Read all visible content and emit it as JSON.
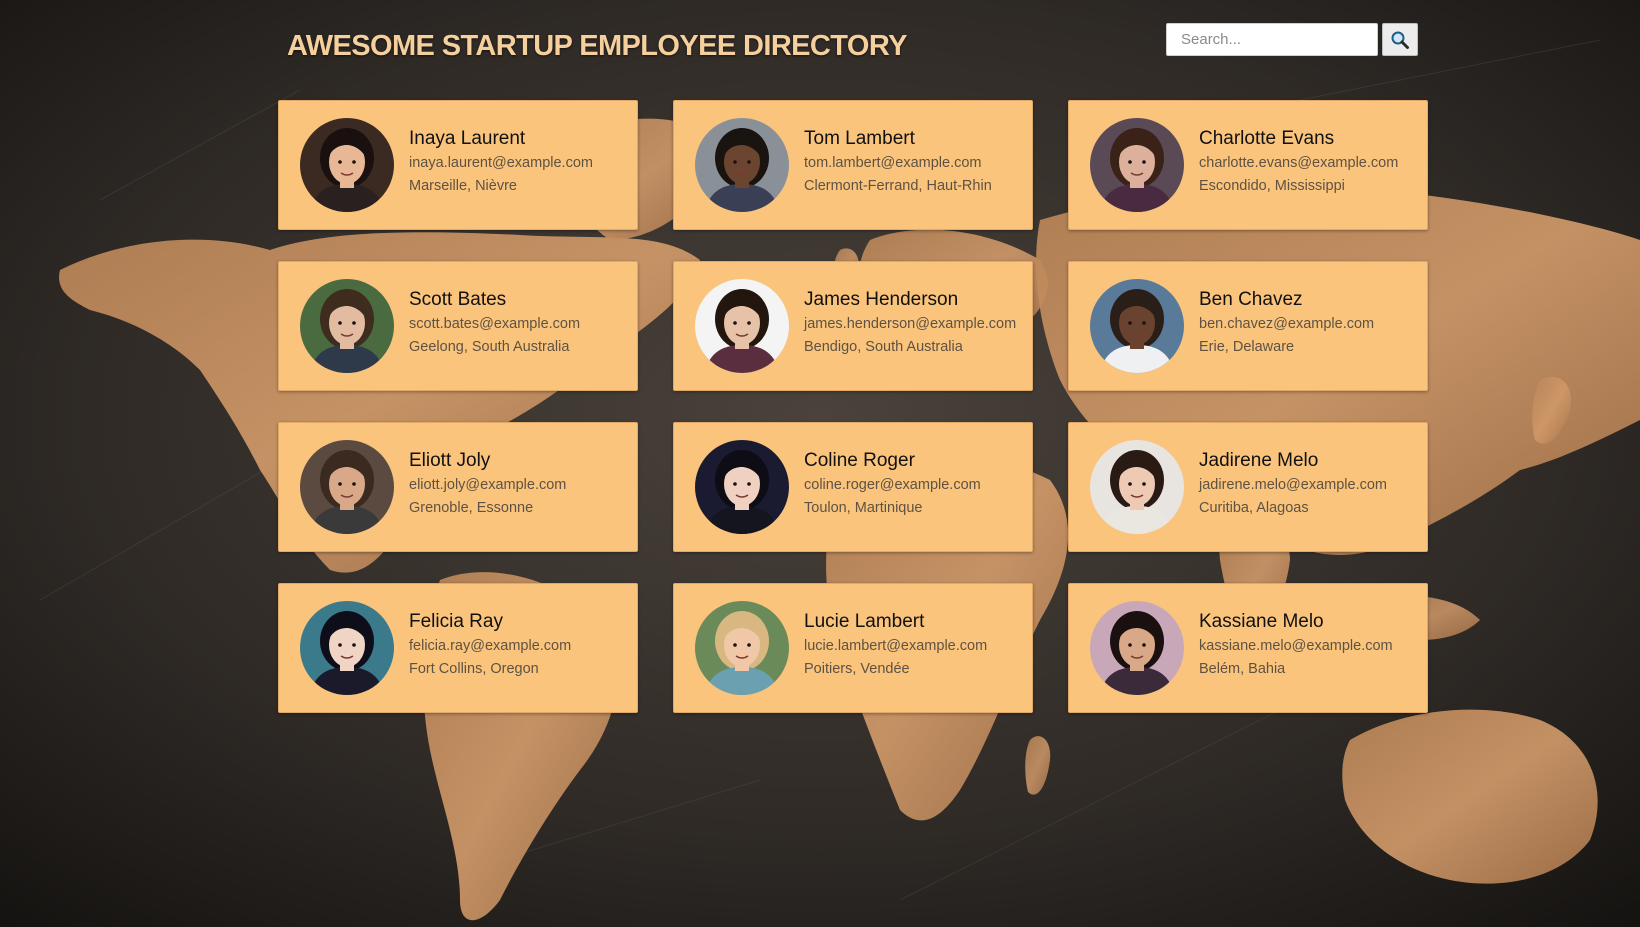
{
  "header": {
    "title": "AWESOME STARTUP EMPLOYEE DIRECTORY",
    "search_placeholder": "Search...",
    "search_icon": "magnifying-glass-icon"
  },
  "colors": {
    "title": "#f5cf9c",
    "card_background": "#fac47d",
    "page_background": "#2a2622",
    "map_land": "#c08a5c"
  },
  "employees": [
    {
      "name": "Inaya Laurent",
      "email": "inaya.laurent@example.com",
      "location": "Marseille, Nièvre",
      "skin": "#e8b896",
      "hair": "#1a1010",
      "bg": "#3a2a22",
      "shirt": "#2a2020"
    },
    {
      "name": "Tom Lambert",
      "email": "tom.lambert@example.com",
      "location": "Clermont-Ferrand, Haut-Rhin",
      "skin": "#6b4530",
      "hair": "#1a1410",
      "bg": "#8a9098",
      "shirt": "#3a3f55"
    },
    {
      "name": "Charlotte Evans",
      "email": "charlotte.evans@example.com",
      "location": "Escondido, Mississippi",
      "skin": "#dcb09a",
      "hair": "#3a2218",
      "bg": "#5a4a55",
      "shirt": "#4a2a40"
    },
    {
      "name": "Scott Bates",
      "email": "scott.bates@example.com",
      "location": "Geelong, South Australia",
      "skin": "#e2bba0",
      "hair": "#3e2c1e",
      "bg": "#4a6a40",
      "shirt": "#2e3a4a"
    },
    {
      "name": "James Henderson",
      "email": "james.henderson@example.com",
      "location": "Bendigo, South Australia",
      "skin": "#e6c2a8",
      "hair": "#22160f",
      "bg": "#f4f4f4",
      "shirt": "#5a2e3e"
    },
    {
      "name": "Ben Chavez",
      "email": "ben.chavez@example.com",
      "location": "Erie, Delaware",
      "skin": "#6a4330",
      "hair": "#2a1e18",
      "bg": "#5a7a9a",
      "shirt": "#eef0f2"
    },
    {
      "name": "Eliott Joly",
      "email": "eliott.joly@example.com",
      "location": "Grenoble, Essonne",
      "skin": "#d8a888",
      "hair": "#3a2a20",
      "bg": "#5a4a40",
      "shirt": "#3a3a3a"
    },
    {
      "name": "Coline Roger",
      "email": "coline.roger@example.com",
      "location": "Toulon, Martinique",
      "skin": "#f0d0c0",
      "hair": "#0e0c14",
      "bg": "#1a1a30",
      "shirt": "#15151f"
    },
    {
      "name": "Jadirene Melo",
      "email": "jadirene.melo@example.com",
      "location": "Curitiba, Alagoas",
      "skin": "#eecab4",
      "hair": "#2a1a14",
      "bg": "#e8e4e0",
      "shirt": "#eae6e0"
    },
    {
      "name": "Felicia Ray",
      "email": "felicia.ray@example.com",
      "location": "Fort Collins, Oregon",
      "skin": "#f0d4c4",
      "hair": "#0e0e1a",
      "bg": "#3a7a8a",
      "shirt": "#1a1a2a"
    },
    {
      "name": "Lucie Lambert",
      "email": "lucie.lambert@example.com",
      "location": "Poitiers, Vendée",
      "skin": "#f0c8a8",
      "hair": "#d8b880",
      "bg": "#6a8a5a",
      "shirt": "#6aa0b0"
    },
    {
      "name": "Kassiane Melo",
      "email": "kassiane.melo@example.com",
      "location": "Belém, Bahia",
      "skin": "#d8a888",
      "hair": "#1a1010",
      "bg": "#c8a8b8",
      "shirt": "#3a2a3a"
    }
  ]
}
